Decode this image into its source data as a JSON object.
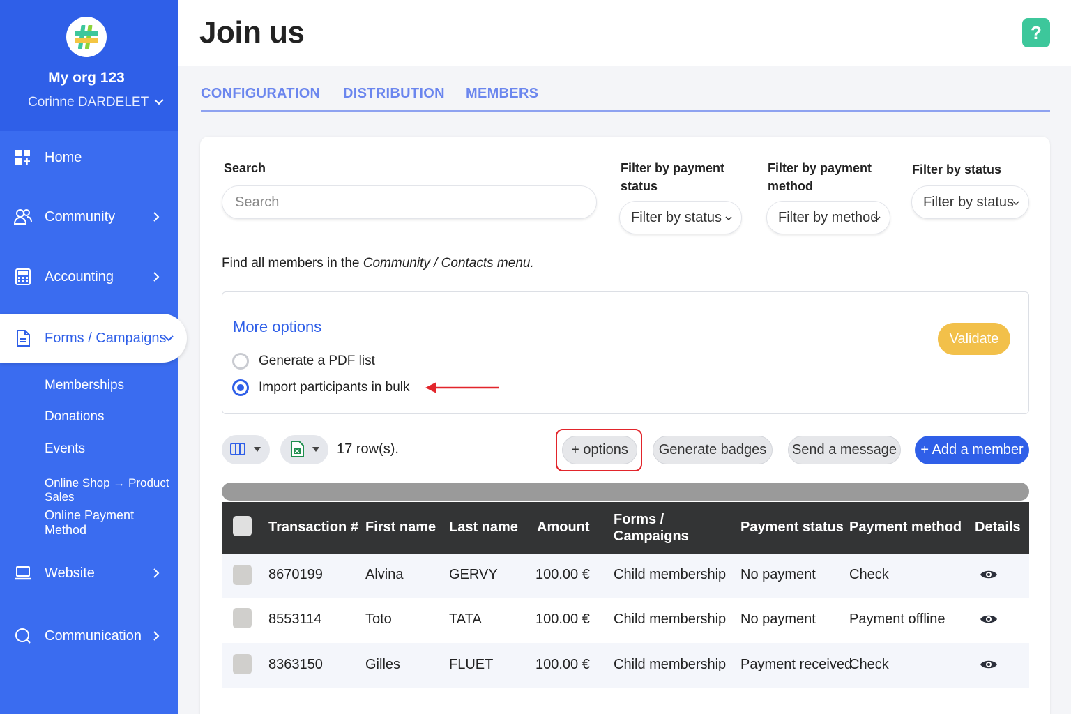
{
  "org": {
    "name": "My org 123",
    "user": "Corinne DARDELET"
  },
  "sidebar": {
    "items": [
      {
        "label": "Home",
        "icon": "dashboard-icon"
      },
      {
        "label": "Community",
        "icon": "people-icon"
      },
      {
        "label": "Accounting",
        "icon": "calculator-icon"
      },
      {
        "label": "Forms / Campaigns",
        "icon": "document-icon"
      },
      {
        "label": "Website",
        "icon": "laptop-icon"
      },
      {
        "label": "Communication",
        "icon": "chat-icon"
      }
    ],
    "subitems": [
      "Memberships",
      "Donations",
      "Events",
      "Online Shop → Product Sales",
      "Online Payment Method"
    ]
  },
  "header": {
    "title": "Join us",
    "help": "?"
  },
  "tabs": [
    "CONFIGURATION",
    "DISTRIBUTION",
    "MEMBERS"
  ],
  "filters": {
    "search_label": "Search",
    "search_placeholder": "Search",
    "payment_status_label": "Filter by payment status",
    "payment_status_value": "Filter by status",
    "payment_method_label": "Filter by payment method",
    "payment_method_value": "Filter by method",
    "status_label": "Filter by status",
    "status_value": "Filter by status"
  },
  "info": {
    "prefix": "Find all members in the ",
    "link": "Community / Contacts menu."
  },
  "more_options": {
    "title": "More options",
    "options": [
      "Generate a PDF list",
      "Import participants in bulk"
    ],
    "selected_index": 1,
    "validate": "Validate"
  },
  "toolbar": {
    "rows": "17 row(s).",
    "options": "+ options",
    "badges": "Generate badges",
    "message": "Send a message",
    "add": "+ Add a member"
  },
  "table": {
    "headers": [
      "Transaction #",
      "First name",
      "Last name",
      "Amount",
      "Forms / Campaigns",
      "Payment status",
      "Payment method",
      "Details"
    ],
    "rows": [
      [
        "8670199",
        "Alvina",
        "GERVY",
        "100.00 €",
        "Child membership",
        "No payment",
        "Check"
      ],
      [
        "8553114",
        "Toto",
        "TATA",
        "100.00 €",
        "Child membership",
        "No payment",
        "Payment offline"
      ],
      [
        "8363150",
        "Gilles",
        "FLUET",
        "100.00 €",
        "Child membership",
        "Payment received",
        "Check"
      ]
    ]
  },
  "colors": {
    "primary": "#2f5fe8",
    "accent": "#f2c04a",
    "help": "#3dc79b",
    "highlight": "#e2252b"
  }
}
